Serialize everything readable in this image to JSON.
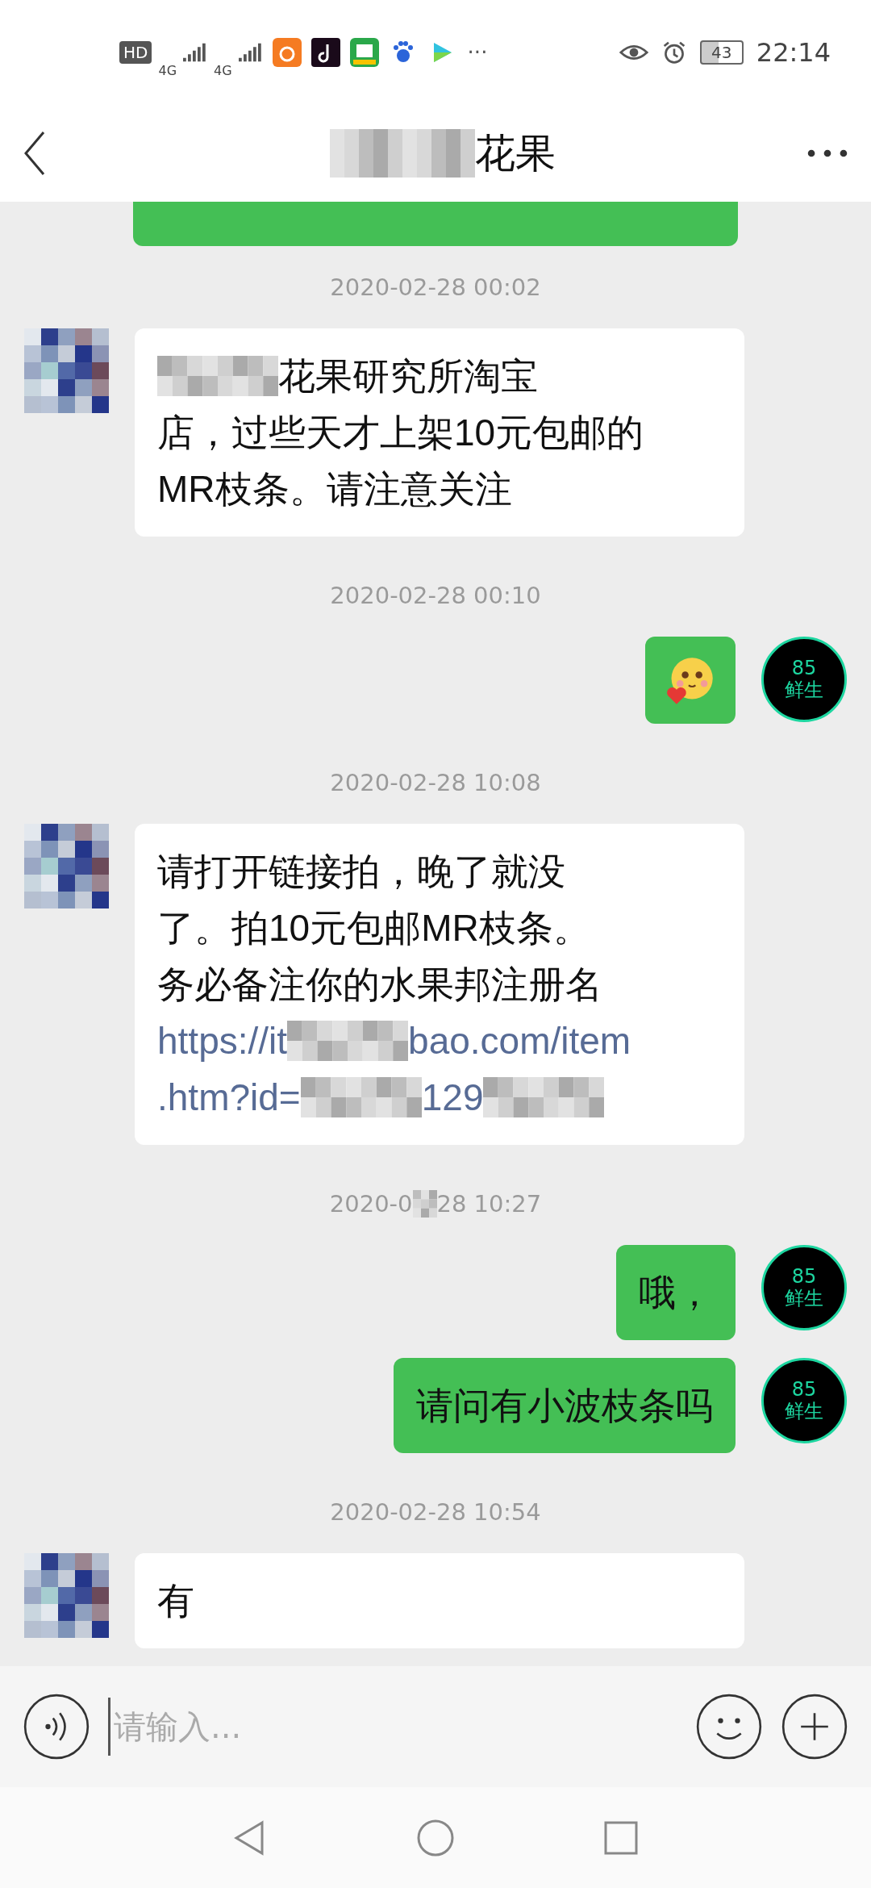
{
  "status_bar": {
    "hd": "HD",
    "signal_1": "4G",
    "signal_2": "4G",
    "more": "···",
    "battery": "43",
    "time": "22:14"
  },
  "header": {
    "title": "花果"
  },
  "messages": [
    {
      "kind": "partial",
      "outgoing": true
    },
    {
      "kind": "time",
      "parts": [
        {
          "kind": "text",
          "text": "2020-02-28 00:02"
        }
      ]
    },
    {
      "kind": "text",
      "outgoing": false,
      "lines": [
        [
          {
            "kind": "redacted"
          },
          {
            "kind": "text",
            "text": "花果研究所淘宝"
          }
        ],
        [
          {
            "kind": "text",
            "text": "店，过些天才上架10元包邮的"
          }
        ],
        [
          {
            "kind": "text",
            "text": "MR枝条。请注意关注"
          }
        ]
      ]
    },
    {
      "kind": "time",
      "parts": [
        {
          "kind": "text",
          "text": "2020-02-28 00:10"
        }
      ]
    },
    {
      "kind": "emoji",
      "outgoing": true,
      "avatar": {
        "number": "85",
        "name": "鲜生"
      }
    },
    {
      "kind": "time",
      "parts": [
        {
          "kind": "text",
          "text": "2020-02-28 10:08"
        }
      ]
    },
    {
      "kind": "text",
      "outgoing": false,
      "lines": [
        [
          {
            "kind": "text",
            "text": "请打开链接拍，晚了就没"
          }
        ],
        [
          {
            "kind": "text",
            "text": "了。拍10元包邮MR枝条。"
          }
        ],
        [
          {
            "kind": "text",
            "text": "务必备注你的水果邦注册名"
          }
        ],
        [
          {
            "kind": "link",
            "text": "https://it"
          },
          {
            "kind": "redacted"
          },
          {
            "kind": "link",
            "text": "bao.com/item"
          }
        ],
        [
          {
            "kind": "link",
            "text": ".htm?id="
          },
          {
            "kind": "redacted"
          },
          {
            "kind": "link",
            "text": "129"
          },
          {
            "kind": "redacted"
          }
        ]
      ]
    },
    {
      "kind": "time",
      "parts": [
        {
          "kind": "text",
          "text": "2020-0"
        },
        {
          "kind": "redacted"
        },
        {
          "kind": "text",
          "text": "28 10:27"
        }
      ]
    },
    {
      "kind": "text",
      "outgoing": true,
      "lines": [
        [
          {
            "kind": "text",
            "text": "哦，"
          }
        ]
      ],
      "avatar": {
        "number": "85",
        "name": "鲜生"
      }
    },
    {
      "kind": "text",
      "outgoing": true,
      "lines": [
        [
          {
            "kind": "text",
            "text": "请问有小波枝条吗"
          }
        ]
      ],
      "avatar": {
        "number": "85",
        "name": "鲜生"
      }
    },
    {
      "kind": "time",
      "parts": [
        {
          "kind": "text",
          "text": "2020-02-28 10:54"
        }
      ]
    },
    {
      "kind": "text",
      "outgoing": false,
      "lines": [
        [
          {
            "kind": "text",
            "text": "有"
          }
        ]
      ]
    }
  ],
  "input": {
    "placeholder": "请输入..."
  }
}
